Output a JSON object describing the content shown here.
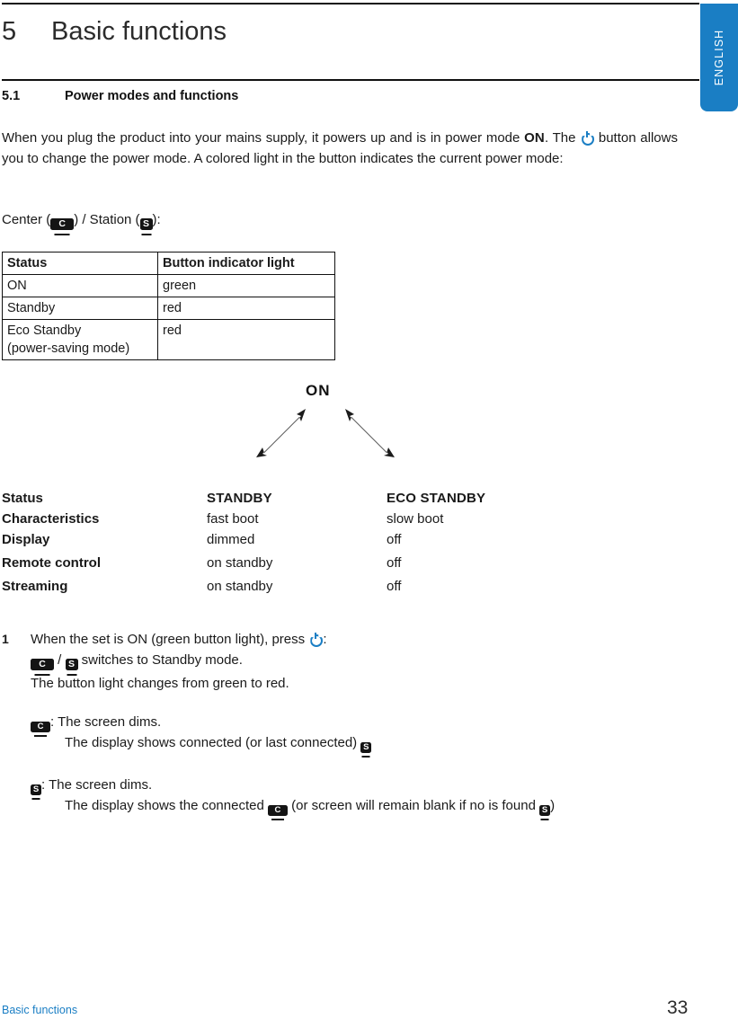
{
  "page": {
    "language_tab": "ENGLISH",
    "chapter_number": "5",
    "chapter_title": "Basic functions",
    "section_number": "5.1",
    "section_title": "Power modes and functions"
  },
  "intro": {
    "part1": "When you plug the product into your mains supply, it powers up and is in power mode ",
    "on_bold": "ON",
    "part2": ". The ",
    "power_icon": "power-icon",
    "part3": " button allows you to change the power mode. A colored light in the button indicates the current power mode:"
  },
  "center_station_line": {
    "prefix": "Center (",
    "center_icon_label": "C",
    "middle": ") / Station (",
    "station_icon_label": "S",
    "suffix": "):"
  },
  "status_table": {
    "headers": [
      "Status",
      "Button indicator light"
    ],
    "rows": [
      [
        "ON",
        "green"
      ],
      [
        "Standby",
        "red"
      ],
      [
        "Eco Standby\n(power-saving mode)",
        "red"
      ]
    ],
    "row3_line1": "Eco Standby",
    "row3_line2": "(power-saving mode)"
  },
  "diagram": {
    "label": "ON",
    "arrow_left": "double-headed-arrow-down-left",
    "arrow_right": "double-headed-arrow-down-right"
  },
  "comparison": {
    "rows": [
      {
        "label": "Status",
        "standby": "STANDBY",
        "eco": "ECO STANDBY"
      },
      {
        "label": "Characteristics",
        "standby": "fast boot",
        "eco": "slow boot"
      },
      {
        "label": "Display",
        "standby": "dimmed",
        "eco": "off"
      },
      {
        "label": "Remote control",
        "standby": "on standby",
        "eco": "off"
      },
      {
        "label": "Streaming",
        "standby": "on standby",
        "eco": "off"
      }
    ]
  },
  "steps": {
    "number": "1",
    "line1": "When the set is ON (green button light), press ",
    "line1_suffix": ":",
    "line2_separator": " / ",
    "line2_text": " switches to Standby mode.",
    "line3": "The button light changes from green to red.",
    "center_colon": ": The screen dims.",
    "center_display": "The display shows connected (or last connected) ",
    "station_colon": ":  The screen dims.",
    "station_display_a": "The display shows the connected ",
    "station_display_b": " (or screen will remain blank if no is found ",
    "station_display_c": ")"
  },
  "footer": {
    "left": "Basic functions",
    "page_number": "33"
  },
  "colors": {
    "accent_blue": "#1a7ec4",
    "text": "#1a1a1a",
    "rule": "#111111"
  }
}
